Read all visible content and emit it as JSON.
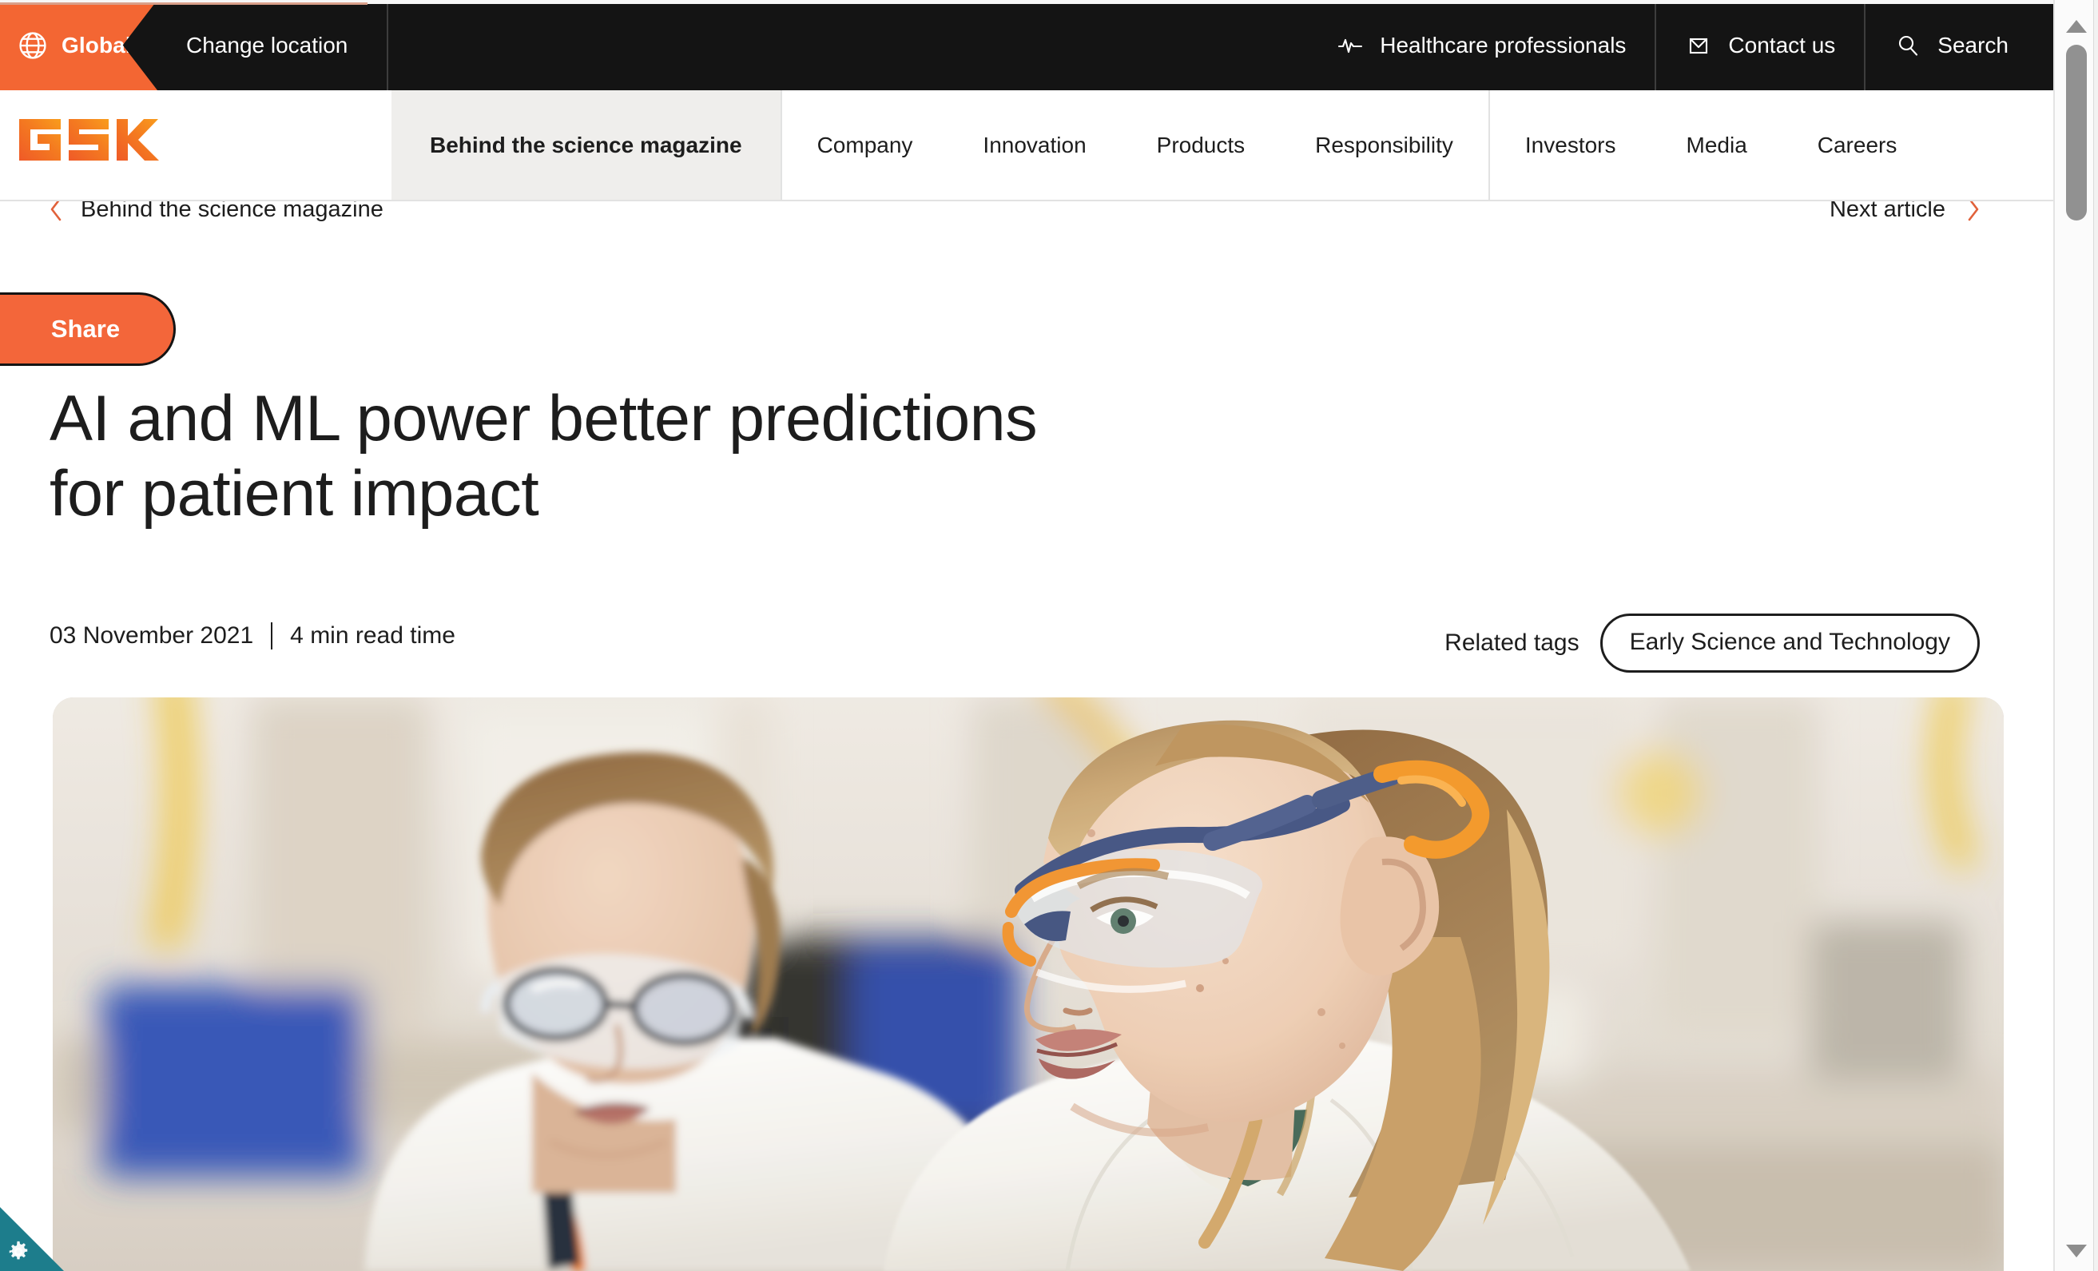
{
  "utility_bar": {
    "global_badge": {
      "label": "Global",
      "icon": "globe-icon"
    },
    "change_location": "Change location",
    "items": [
      {
        "label": "Healthcare professionals",
        "icon": "pulse-icon"
      },
      {
        "label": "Contact us",
        "icon": "envelope-icon"
      },
      {
        "label": "Search",
        "icon": "search-icon"
      }
    ]
  },
  "brand": {
    "name": "GSK",
    "color": "#f36633"
  },
  "main_nav": {
    "items": [
      {
        "label": "Behind the science magazine",
        "active": true
      },
      {
        "label": "Company",
        "active": false
      },
      {
        "label": "Innovation",
        "active": false
      },
      {
        "label": "Products",
        "active": false
      },
      {
        "label": "Responsibility",
        "active": false
      },
      {
        "label": "Investors",
        "active": false
      },
      {
        "label": "Media",
        "active": false
      },
      {
        "label": "Careers",
        "active": false
      }
    ]
  },
  "breadcrumb": {
    "back_label": "Behind the science magazine",
    "next_label": "Next article",
    "chevron_color": "#e1613a"
  },
  "article": {
    "share_label": "Share",
    "title": "AI and ML power better predictions for patient impact",
    "title_line1": "AI and ML power better predictions",
    "title_line2": "for patient impact",
    "date": "03 November 2021",
    "read_time": "4 min read time",
    "related_tags_label": "Related tags",
    "tags": [
      "Early Science and Technology"
    ],
    "hero_image_alt": "Two scientists wearing white lab coats and safety goggles working in a laboratory"
  },
  "privacy_widget": {
    "icon": "gear-icon",
    "color": "#1d7d8c"
  },
  "scrollbar": {
    "up_icon": "triangle-up-icon",
    "down_icon": "triangle-down-icon"
  },
  "colors": {
    "brand_orange": "#f36633",
    "share_orange": "#f3663a",
    "utility_black": "#141414",
    "active_tab_grey": "#efeeec",
    "text": "#1d1d1d",
    "teal": "#1d7d8c"
  }
}
